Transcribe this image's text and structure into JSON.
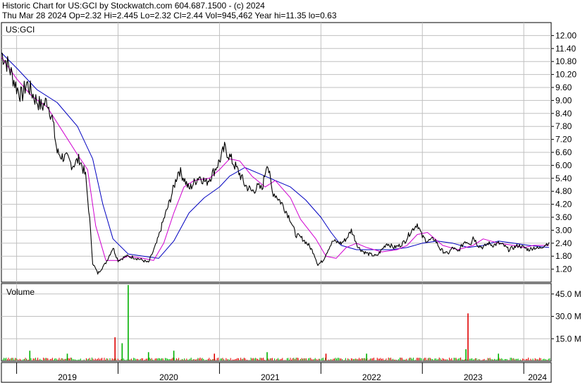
{
  "header": {
    "line1": "Historic Chart for US:GCI by Stockwatch.com 604.687.1500 - (c) 2024",
    "line2": "Thu Mar 28 2024   Op=2.32   Hi=2.445   Lo=2.32   Cl=2.44   Vol=945,462   Year hi=11.35   lo=0.63"
  },
  "colors": {
    "price": "#000000",
    "ma_short": "#d000d0",
    "ma_long": "#0000c0",
    "vol_up": "#00b000",
    "vol_down": "#e00000",
    "grid": "#c0c0c0",
    "frame": "#000000"
  },
  "chart_data": [
    {
      "type": "line",
      "symbol": "US:GCI",
      "title": "US:GCI",
      "y_axis_side": "right",
      "ylim": [
        0.6,
        12.6
      ],
      "yticks": [
        "12.00",
        "11.40",
        "10.80",
        "10.20",
        "9.60",
        "9.00",
        "8.40",
        "7.80",
        "7.20",
        "6.60",
        "6.00",
        "5.40",
        "4.80",
        "4.20",
        "3.60",
        "3.00",
        "2.40",
        "1.80",
        "1.20"
      ],
      "grid": true,
      "x_labels": [
        "2019",
        "2020",
        "2021",
        "2022",
        "2023",
        "2024"
      ],
      "x_range": [
        2018.85,
        2024.27
      ],
      "series": [
        {
          "role": "close",
          "x": [
            2018.85,
            2018.92,
            2019.0,
            2019.05,
            2019.1,
            2019.18,
            2019.25,
            2019.3,
            2019.35,
            2019.4,
            2019.45,
            2019.5,
            2019.55,
            2019.62,
            2019.68,
            2019.72,
            2019.75,
            2019.8,
            2019.85,
            2019.88,
            2019.95,
            2020.0,
            2020.08,
            2020.15,
            2020.22,
            2020.3,
            2020.38,
            2020.45,
            2020.5,
            2020.55,
            2020.6,
            2020.65,
            2020.7,
            2020.75,
            2020.8,
            2020.87,
            2020.93,
            2021.0,
            2021.05,
            2021.1,
            2021.15,
            2021.2,
            2021.25,
            2021.32,
            2021.38,
            2021.42,
            2021.47,
            2021.52,
            2021.56,
            2021.62,
            2021.7,
            2021.75,
            2021.82,
            2021.88,
            2021.93,
            2021.97,
            2022.02,
            2022.08,
            2022.12,
            2022.2,
            2022.25,
            2022.3,
            2022.37,
            2022.42,
            2022.47,
            2022.55,
            2022.6,
            2022.65,
            2022.72,
            2022.78,
            2022.83,
            2022.88,
            2022.95,
            2023.0,
            2023.05,
            2023.12,
            2023.18,
            2023.25,
            2023.3,
            2023.35,
            2023.42,
            2023.48,
            2023.5,
            2023.55,
            2023.6,
            2023.65,
            2023.7,
            2023.75,
            2023.8,
            2023.85,
            2023.9,
            2023.95,
            2024.0,
            2024.05,
            2024.1,
            2024.15,
            2024.2,
            2024.25
          ],
          "values": [
            11.2,
            10.6,
            9.6,
            9.2,
            9.8,
            9.1,
            8.7,
            9.0,
            8.2,
            6.6,
            6.4,
            6.3,
            6.0,
            6.3,
            5.5,
            3.5,
            1.5,
            1.0,
            1.3,
            1.5,
            2.2,
            1.6,
            1.8,
            1.75,
            1.65,
            1.5,
            2.4,
            3.5,
            4.2,
            5.0,
            5.8,
            5.4,
            4.9,
            5.2,
            5.5,
            5.2,
            5.6,
            6.2,
            6.8,
            6.4,
            6.0,
            5.6,
            5.1,
            4.8,
            5.0,
            4.9,
            6.2,
            4.8,
            4.6,
            4.2,
            3.5,
            2.8,
            2.6,
            2.3,
            1.95,
            1.4,
            1.6,
            2.2,
            2.5,
            2.4,
            2.6,
            3.0,
            2.2,
            2.0,
            1.9,
            1.8,
            2.1,
            2.4,
            2.2,
            2.3,
            2.5,
            2.9,
            3.3,
            2.7,
            2.5,
            2.6,
            2.1,
            1.9,
            2.2,
            2.0,
            2.5,
            2.4,
            2.7,
            2.3,
            2.2,
            2.4,
            2.3,
            2.4,
            2.3,
            2.1,
            2.2,
            2.3,
            2.2,
            2.1,
            2.2,
            2.15,
            2.3,
            2.44
          ]
        },
        {
          "role": "moving-average-short",
          "x": [
            2018.85,
            2019.0,
            2019.15,
            2019.3,
            2019.45,
            2019.6,
            2019.7,
            2019.78,
            2019.88,
            2020.0,
            2020.1,
            2020.25,
            2020.35,
            2020.45,
            2020.55,
            2020.65,
            2020.75,
            2020.9,
            2021.0,
            2021.1,
            2021.2,
            2021.32,
            2021.45,
            2021.55,
            2021.7,
            2021.8,
            2021.95,
            2022.05,
            2022.15,
            2022.25,
            2022.35,
            2022.45,
            2022.6,
            2022.75,
            2022.85,
            2022.95,
            2023.05,
            2023.2,
            2023.35,
            2023.5,
            2023.6,
            2023.75,
            2023.9,
            2024.0,
            2024.1,
            2024.25
          ],
          "values": [
            11.0,
            10.0,
            9.2,
            8.7,
            7.6,
            6.5,
            5.8,
            3.2,
            1.6,
            1.6,
            1.8,
            1.7,
            1.6,
            2.4,
            3.8,
            5.0,
            5.3,
            5.4,
            5.8,
            6.3,
            6.2,
            5.5,
            5.0,
            5.3,
            4.5,
            3.5,
            2.6,
            1.8,
            1.7,
            2.2,
            2.4,
            2.2,
            2.0,
            2.1,
            2.3,
            2.8,
            2.9,
            2.3,
            2.1,
            2.3,
            2.6,
            2.4,
            2.3,
            2.2,
            2.3,
            2.3
          ]
        },
        {
          "role": "moving-average-long",
          "x": [
            2018.85,
            2019.0,
            2019.2,
            2019.4,
            2019.6,
            2019.75,
            2019.85,
            2019.95,
            2020.1,
            2020.25,
            2020.4,
            2020.55,
            2020.7,
            2020.85,
            2021.0,
            2021.1,
            2021.25,
            2021.4,
            2021.55,
            2021.7,
            2021.85,
            2022.0,
            2022.1,
            2022.2,
            2022.35,
            2022.5,
            2022.7,
            2022.85,
            2023.0,
            2023.15,
            2023.3,
            2023.45,
            2023.6,
            2023.75,
            2023.9,
            2024.05,
            2024.25
          ],
          "values": [
            11.2,
            10.5,
            9.5,
            8.9,
            7.8,
            6.3,
            4.2,
            2.6,
            1.9,
            1.8,
            1.7,
            2.5,
            3.8,
            4.5,
            5.0,
            5.5,
            5.9,
            5.6,
            5.3,
            5.0,
            4.4,
            3.6,
            2.9,
            2.3,
            2.1,
            2.1,
            2.1,
            2.2,
            2.4,
            2.5,
            2.4,
            2.2,
            2.3,
            2.5,
            2.4,
            2.3,
            2.2
          ]
        }
      ]
    },
    {
      "type": "bar",
      "title": "Volume",
      "y_axis_side": "right",
      "ylim": [
        0,
        52
      ],
      "yticks": [
        "45.0 M",
        "30.0 M",
        "15.0 M"
      ],
      "grid": true,
      "unit": "M",
      "spikes": [
        {
          "x": 2019.13,
          "value": 7,
          "direction": "up"
        },
        {
          "x": 2019.5,
          "value": 5,
          "direction": "up"
        },
        {
          "x": 2019.97,
          "value": 16,
          "direction": "down"
        },
        {
          "x": 2020.04,
          "value": 12,
          "direction": "up"
        },
        {
          "x": 2020.1,
          "value": 51,
          "direction": "up"
        },
        {
          "x": 2020.3,
          "value": 6,
          "direction": "up"
        },
        {
          "x": 2020.55,
          "value": 7,
          "direction": "up"
        },
        {
          "x": 2020.95,
          "value": 5,
          "direction": "down"
        },
        {
          "x": 2021.47,
          "value": 6,
          "direction": "up"
        },
        {
          "x": 2022.05,
          "value": 5,
          "direction": "down"
        },
        {
          "x": 2022.45,
          "value": 5,
          "direction": "up"
        },
        {
          "x": 2023.45,
          "value": 32,
          "direction": "down"
        },
        {
          "x": 2023.43,
          "value": 8,
          "direction": "up"
        },
        {
          "x": 2023.75,
          "value": 5,
          "direction": "up"
        }
      ]
    }
  ]
}
